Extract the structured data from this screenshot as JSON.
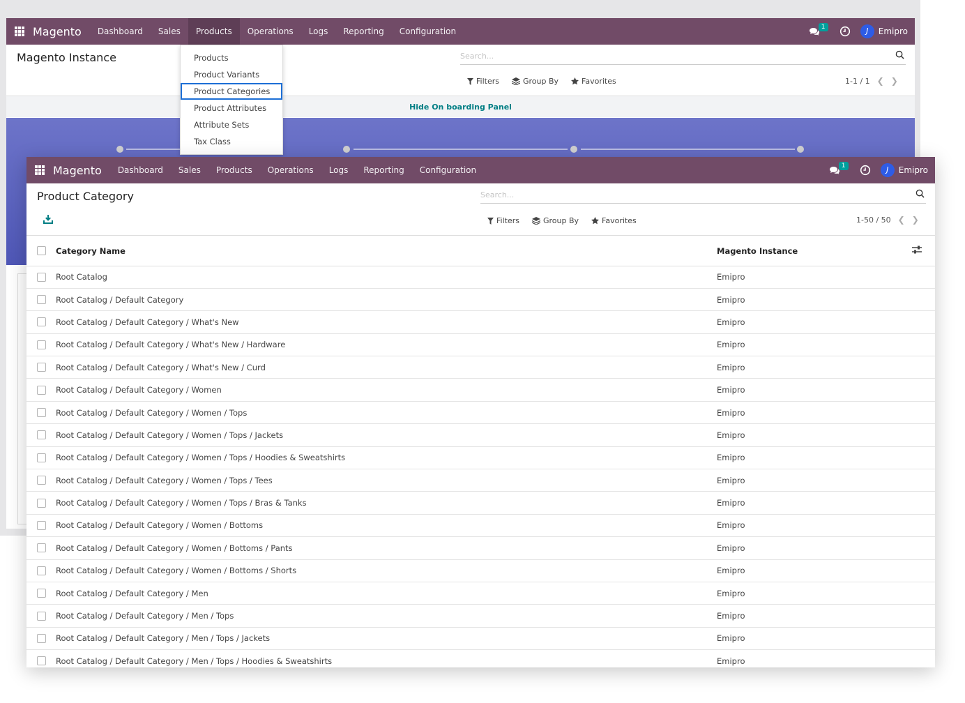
{
  "nav": {
    "brand": "Magento",
    "items": [
      "Dashboard",
      "Sales",
      "Products",
      "Operations",
      "Logs",
      "Reporting",
      "Configuration"
    ],
    "chat_badge": "1",
    "avatar_letter": "J",
    "user": "Emipro"
  },
  "bg_view": {
    "title": "Magento Instance",
    "search_placeholder": "Search...",
    "filters_label": "Filters",
    "groupby_label": "Group By",
    "favorites_label": "Favorites",
    "pager": "1-1 / 1",
    "onboarding_link": "Hide On boarding Panel"
  },
  "products_menu": {
    "items": [
      "Products",
      "Product Variants",
      "Product Categories",
      "Product Attributes",
      "Attribute Sets",
      "Tax Class"
    ]
  },
  "fg_view": {
    "title": "Product Category",
    "search_placeholder": "Search...",
    "filters_label": "Filters",
    "groupby_label": "Group By",
    "favorites_label": "Favorites",
    "pager": "1-50 / 50",
    "columns": {
      "name": "Category Name",
      "instance": "Magento Instance"
    },
    "rows": [
      {
        "name": "Root Catalog",
        "instance": "Emipro"
      },
      {
        "name": "Root Catalog / Default Category",
        "instance": "Emipro"
      },
      {
        "name": "Root Catalog / Default Category / What's New",
        "instance": "Emipro"
      },
      {
        "name": "Root Catalog / Default Category / What's New / Hardware",
        "instance": "Emipro"
      },
      {
        "name": "Root Catalog / Default Category / What's New / Curd",
        "instance": "Emipro"
      },
      {
        "name": "Root Catalog / Default Category / Women",
        "instance": "Emipro"
      },
      {
        "name": "Root Catalog / Default Category / Women / Tops",
        "instance": "Emipro"
      },
      {
        "name": "Root Catalog / Default Category / Women / Tops / Jackets",
        "instance": "Emipro"
      },
      {
        "name": "Root Catalog / Default Category / Women / Tops / Hoodies & Sweatshirts",
        "instance": "Emipro"
      },
      {
        "name": "Root Catalog / Default Category / Women / Tops / Tees",
        "instance": "Emipro"
      },
      {
        "name": "Root Catalog / Default Category / Women / Tops / Bras & Tanks",
        "instance": "Emipro"
      },
      {
        "name": "Root Catalog / Default Category / Women / Bottoms",
        "instance": "Emipro"
      },
      {
        "name": "Root Catalog / Default Category / Women / Bottoms / Pants",
        "instance": "Emipro"
      },
      {
        "name": "Root Catalog / Default Category / Women / Bottoms / Shorts",
        "instance": "Emipro"
      },
      {
        "name": "Root Catalog / Default Category / Men",
        "instance": "Emipro"
      },
      {
        "name": "Root Catalog / Default Category / Men / Tops",
        "instance": "Emipro"
      },
      {
        "name": "Root Catalog / Default Category / Men / Tops / Jackets",
        "instance": "Emipro"
      },
      {
        "name": "Root Catalog / Default Category / Men / Tops / Hoodies & Sweatshirts",
        "instance": "Emipro"
      }
    ]
  },
  "colors": {
    "navbar": "#714b67",
    "accent": "#017e84",
    "highlight": "#1d6fd6",
    "panel": "#5a62bf"
  }
}
